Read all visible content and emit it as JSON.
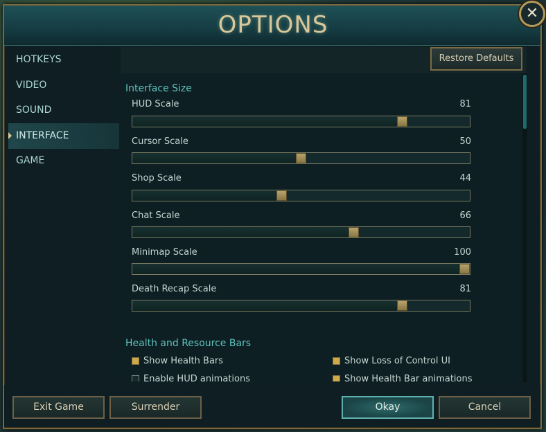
{
  "window": {
    "title": "OPTIONS",
    "close_label": "✕"
  },
  "sidebar": {
    "items": [
      {
        "label": "HOTKEYS",
        "active": false
      },
      {
        "label": "VIDEO",
        "active": false
      },
      {
        "label": "SOUND",
        "active": false
      },
      {
        "label": "INTERFACE",
        "active": true
      },
      {
        "label": "GAME",
        "active": false
      }
    ]
  },
  "toolbar": {
    "restore_label": "Restore Defaults"
  },
  "interface_size": {
    "title": "Interface Size",
    "sliders": [
      {
        "label": "HUD Scale",
        "value": 81
      },
      {
        "label": "Cursor Scale",
        "value": 50
      },
      {
        "label": "Shop Scale",
        "value": 44
      },
      {
        "label": "Chat Scale",
        "value": 66
      },
      {
        "label": "Minimap Scale",
        "value": 100
      },
      {
        "label": "Death Recap Scale",
        "value": 81
      }
    ]
  },
  "health_bars": {
    "title": "Health and Resource Bars",
    "options": [
      {
        "label": "Show Health Bars",
        "checked": true
      },
      {
        "label": "Show Loss of Control UI",
        "checked": true
      },
      {
        "label": "Enable HUD animations",
        "checked": false
      },
      {
        "label": "Show Health Bar animations",
        "checked": true
      }
    ]
  },
  "footer": {
    "exit_label": "Exit Game",
    "surrender_label": "Surrender",
    "okay_label": "Okay",
    "cancel_label": "Cancel"
  },
  "colors": {
    "accent_gold": "#d8c79a",
    "accent_teal": "#5fc2bf",
    "checkbox_on": "#d0a94a"
  }
}
